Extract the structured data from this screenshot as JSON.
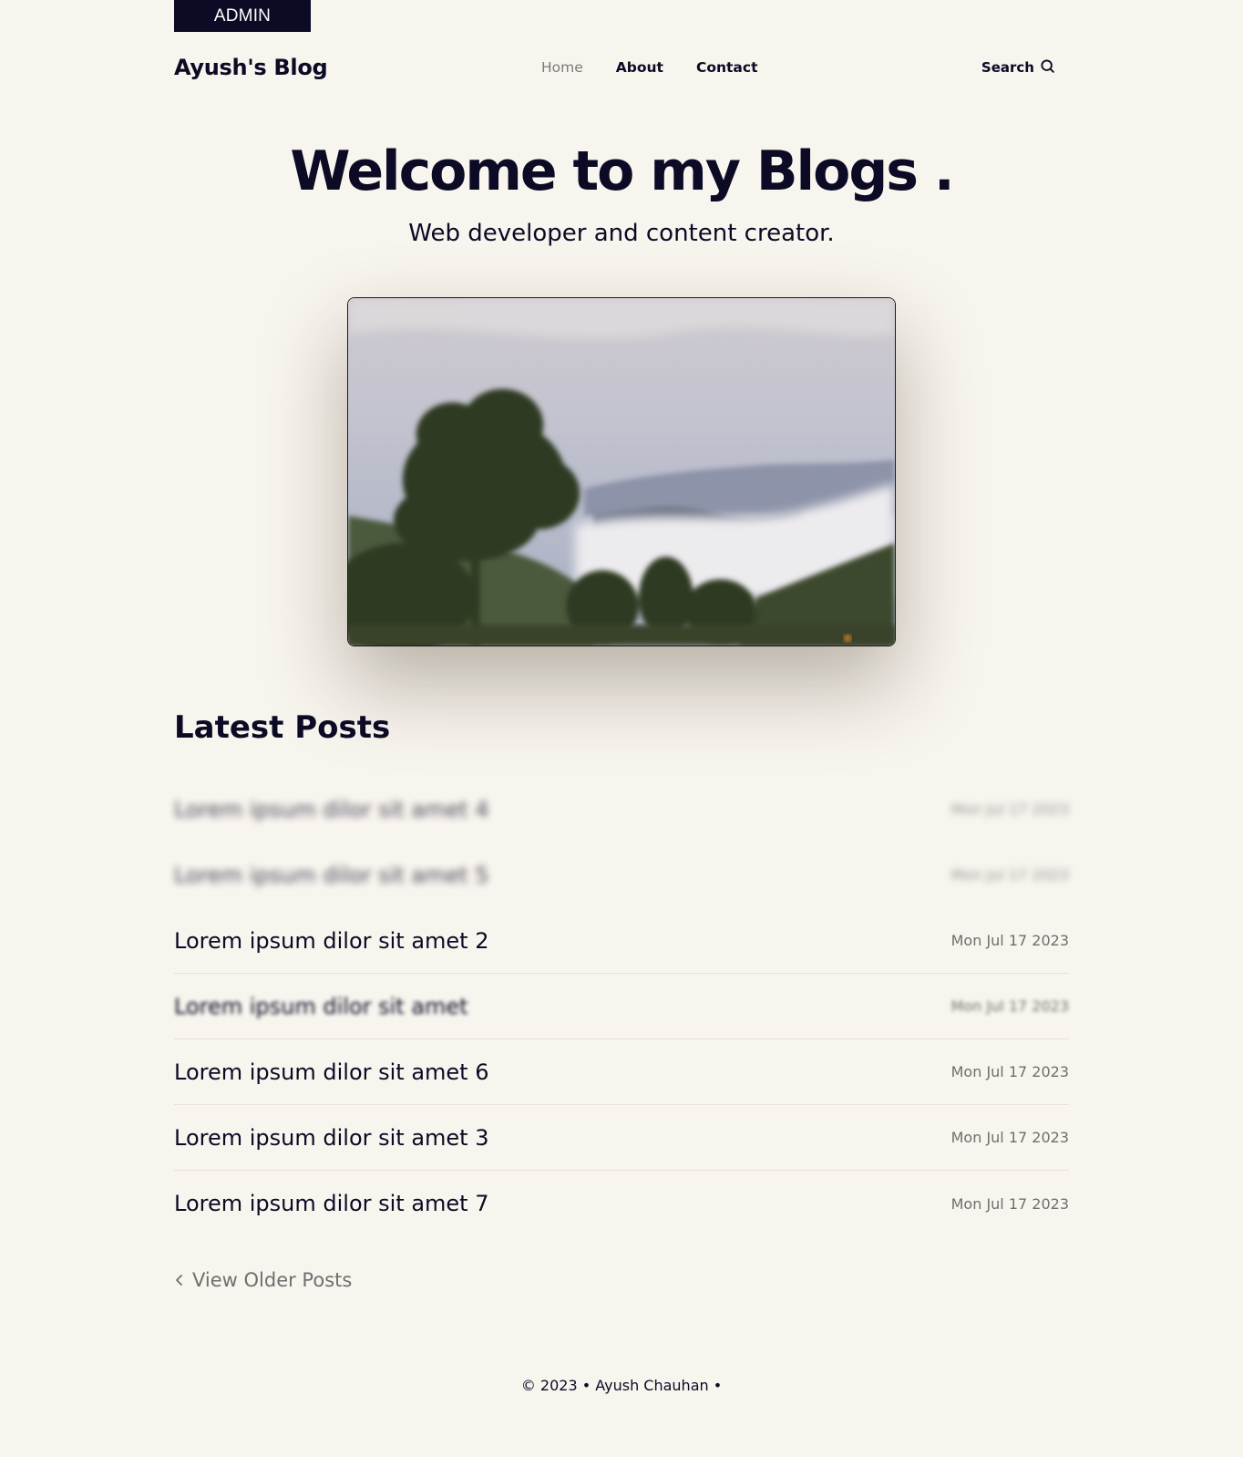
{
  "admin_label": "ADMIN",
  "header": {
    "logo": "Ayush's Blog",
    "nav": [
      {
        "label": "Home"
      },
      {
        "label": "About"
      },
      {
        "label": "Contact"
      }
    ],
    "search_label": "Search"
  },
  "hero": {
    "title": "Welcome to my Blogs .",
    "subtitle": "Web developer and content creator."
  },
  "latest": {
    "heading": "Latest Posts",
    "posts": [
      {
        "title": "Lorem ipsum dilor sit amet 4",
        "date": "Mon Jul 17 2023"
      },
      {
        "title": "Lorem ipsum dilor sit amet 5",
        "date": "Mon Jul 17 2023"
      },
      {
        "title": "Lorem ipsum dilor sit amet 2",
        "date": "Mon Jul 17 2023"
      },
      {
        "title": "Lorem ipsum dilor sit amet",
        "date": "Mon Jul 17 2023"
      },
      {
        "title": "Lorem ipsum dilor sit amet 6",
        "date": "Mon Jul 17 2023"
      },
      {
        "title": "Lorem ipsum dilor sit amet 3",
        "date": "Mon Jul 17 2023"
      },
      {
        "title": "Lorem ipsum dilor sit amet 7",
        "date": "Mon Jul 17 2023"
      }
    ],
    "older_label": "View Older Posts"
  },
  "footer": {
    "text": "© 2023 • Ayush Chauhan •"
  },
  "colors": {
    "background": "#f8f4ee",
    "primary": "#0c0a24",
    "muted": "#6f6f6f"
  }
}
